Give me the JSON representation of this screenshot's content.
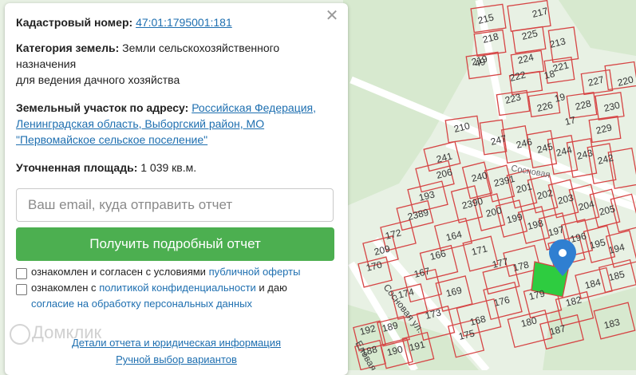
{
  "map": {
    "colors": {
      "background": "#e8f1e4",
      "forest": "#cfe3c7",
      "parcel_line": "#d64545",
      "road": "#ffffff",
      "selected_parcel": "#2ecc40",
      "pin": "#2f7fd1"
    },
    "street_labels": [
      "Сосновая ул.",
      "Еловая ул.",
      "Сосновая"
    ],
    "parcel_numbers": [
      "215",
      "217",
      "218",
      "225",
      "213",
      "219",
      "224",
      "221",
      "222",
      "223",
      "226",
      "227",
      "228",
      "230",
      "229",
      "220",
      "49",
      "210",
      "247",
      "246",
      "245",
      "244",
      "243",
      "242",
      "241",
      "240",
      "2391",
      "201",
      "202",
      "203",
      "204",
      "205",
      "206",
      "2390",
      "200",
      "199",
      "198",
      "197",
      "196",
      "195",
      "194",
      "193",
      "2389",
      "164",
      "171",
      "172",
      "209",
      "166",
      "170",
      "167",
      "169",
      "173",
      "174",
      "175",
      "168",
      "176",
      "177",
      "178",
      "179",
      "180",
      "182",
      "183",
      "184",
      "185",
      "186",
      "187",
      "192",
      "188",
      "189",
      "190",
      "191",
      "18",
      "19",
      "17"
    ],
    "pin_icon": "map-pin-icon"
  },
  "panel": {
    "close_icon": "close-icon",
    "cadastral_label": "Кадастровый номер:",
    "cadastral_value": "47:01:1795001:181",
    "category_label": "Категория земель:",
    "category_value_1": "Земли сельскохозяйственного назначения",
    "category_value_2": "для ведения дачного хозяйства",
    "address_label": "Земельный участок по адресу:",
    "address_value": "Российская Федерация, Ленинградская область, Выборгский район, МО \"Первомайское сельское поселение\"",
    "area_label": "Уточненная площадь:",
    "area_value": "1 039 кв.м.",
    "email_placeholder": "Ваш email, куда отправить отчет",
    "submit_button": "Получить подробный отчет",
    "consent1_text": "ознакомлен и согласен с условиями",
    "consent1_link": "публичной оферты",
    "consent2_text_a": "ознакомлен с",
    "consent2_link_a": "политикой конфиденциальности",
    "consent2_text_b": "и даю",
    "consent2_link_b": "согласие на обработку персональных данных",
    "details_link": "Детали отчета и юридическая информация",
    "manual_link": "Ручной выбор вариантов"
  },
  "watermark": "Домклик"
}
